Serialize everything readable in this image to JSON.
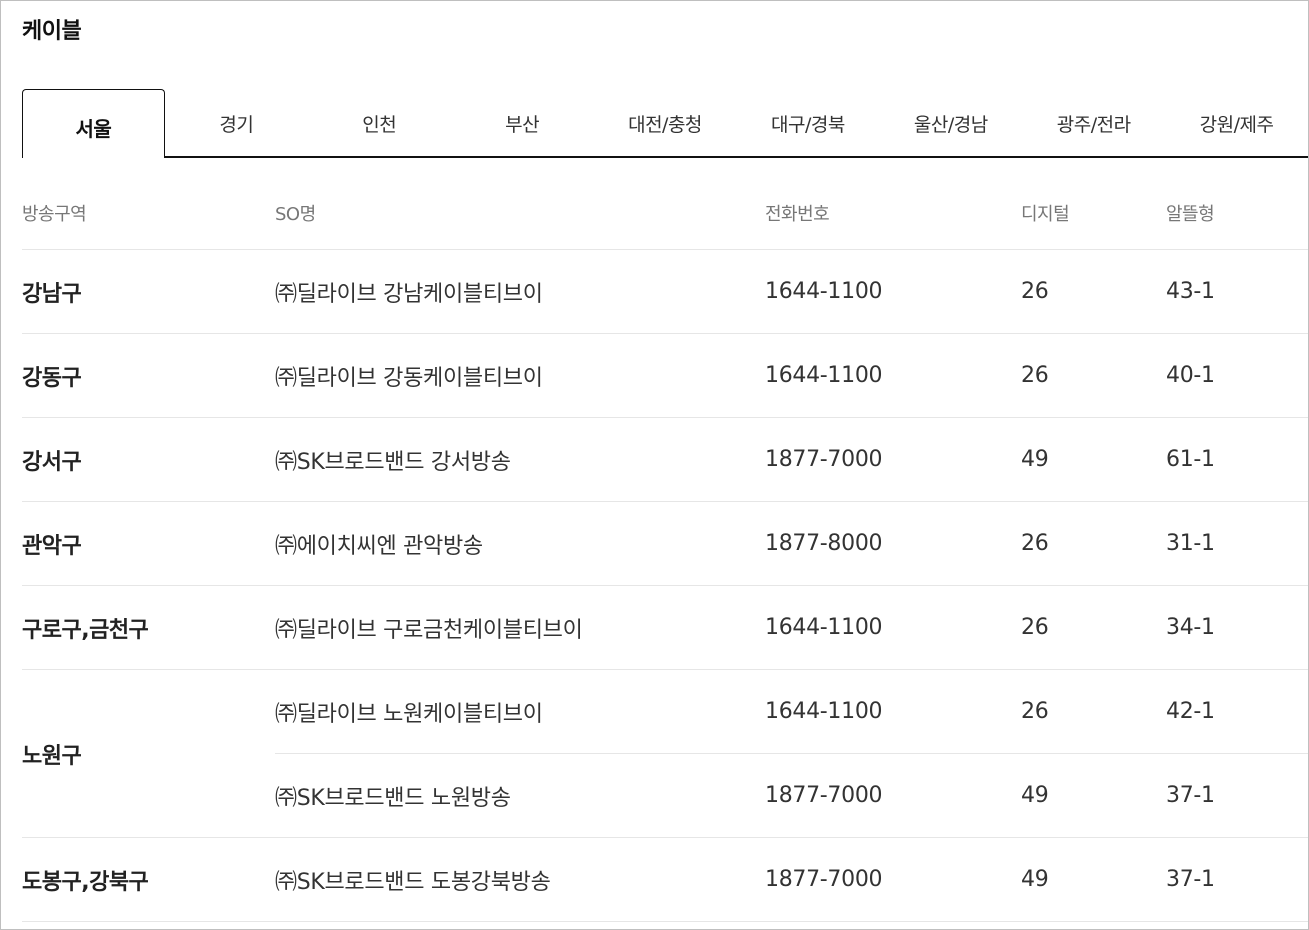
{
  "page": {
    "title": "케이블"
  },
  "tabs": [
    {
      "label": "서울",
      "active": true
    },
    {
      "label": "경기",
      "active": false
    },
    {
      "label": "인천",
      "active": false
    },
    {
      "label": "부산",
      "active": false
    },
    {
      "label": "대전/충청",
      "active": false
    },
    {
      "label": "대구/경북",
      "active": false
    },
    {
      "label": "울산/경남",
      "active": false
    },
    {
      "label": "광주/전라",
      "active": false
    },
    {
      "label": "강원/제주",
      "active": false
    }
  ],
  "table": {
    "headers": {
      "area": "방송구역",
      "so": "SO명",
      "phone": "전화번호",
      "digital": "디지털",
      "budget": "알뜰형"
    },
    "groups": [
      {
        "area": "강남구",
        "rows": [
          {
            "so": "㈜딜라이브 강남케이블티브이",
            "phone": "1644-1100",
            "digital": "26",
            "budget": "43-1"
          }
        ]
      },
      {
        "area": "강동구",
        "rows": [
          {
            "so": "㈜딜라이브 강동케이블티브이",
            "phone": "1644-1100",
            "digital": "26",
            "budget": "40-1"
          }
        ]
      },
      {
        "area": "강서구",
        "rows": [
          {
            "so": "㈜SK브로드밴드 강서방송",
            "phone": "1877-7000",
            "digital": "49",
            "budget": "61-1"
          }
        ]
      },
      {
        "area": "관악구",
        "rows": [
          {
            "so": "㈜에이치씨엔 관악방송",
            "phone": "1877-8000",
            "digital": "26",
            "budget": "31-1"
          }
        ]
      },
      {
        "area": "구로구,금천구",
        "rows": [
          {
            "so": "㈜딜라이브 구로금천케이블티브이",
            "phone": "1644-1100",
            "digital": "26",
            "budget": "34-1"
          }
        ]
      },
      {
        "area": "노원구",
        "rows": [
          {
            "so": "㈜딜라이브 노원케이블티브이",
            "phone": "1644-1100",
            "digital": "26",
            "budget": "42-1"
          },
          {
            "so": "㈜SK브로드밴드 노원방송",
            "phone": "1877-7000",
            "digital": "49",
            "budget": "37-1"
          }
        ]
      },
      {
        "area": "도봉구,강북구",
        "rows": [
          {
            "so": "㈜SK브로드밴드 도봉강북방송",
            "phone": "1877-7000",
            "digital": "49",
            "budget": "37-1"
          }
        ]
      }
    ]
  }
}
